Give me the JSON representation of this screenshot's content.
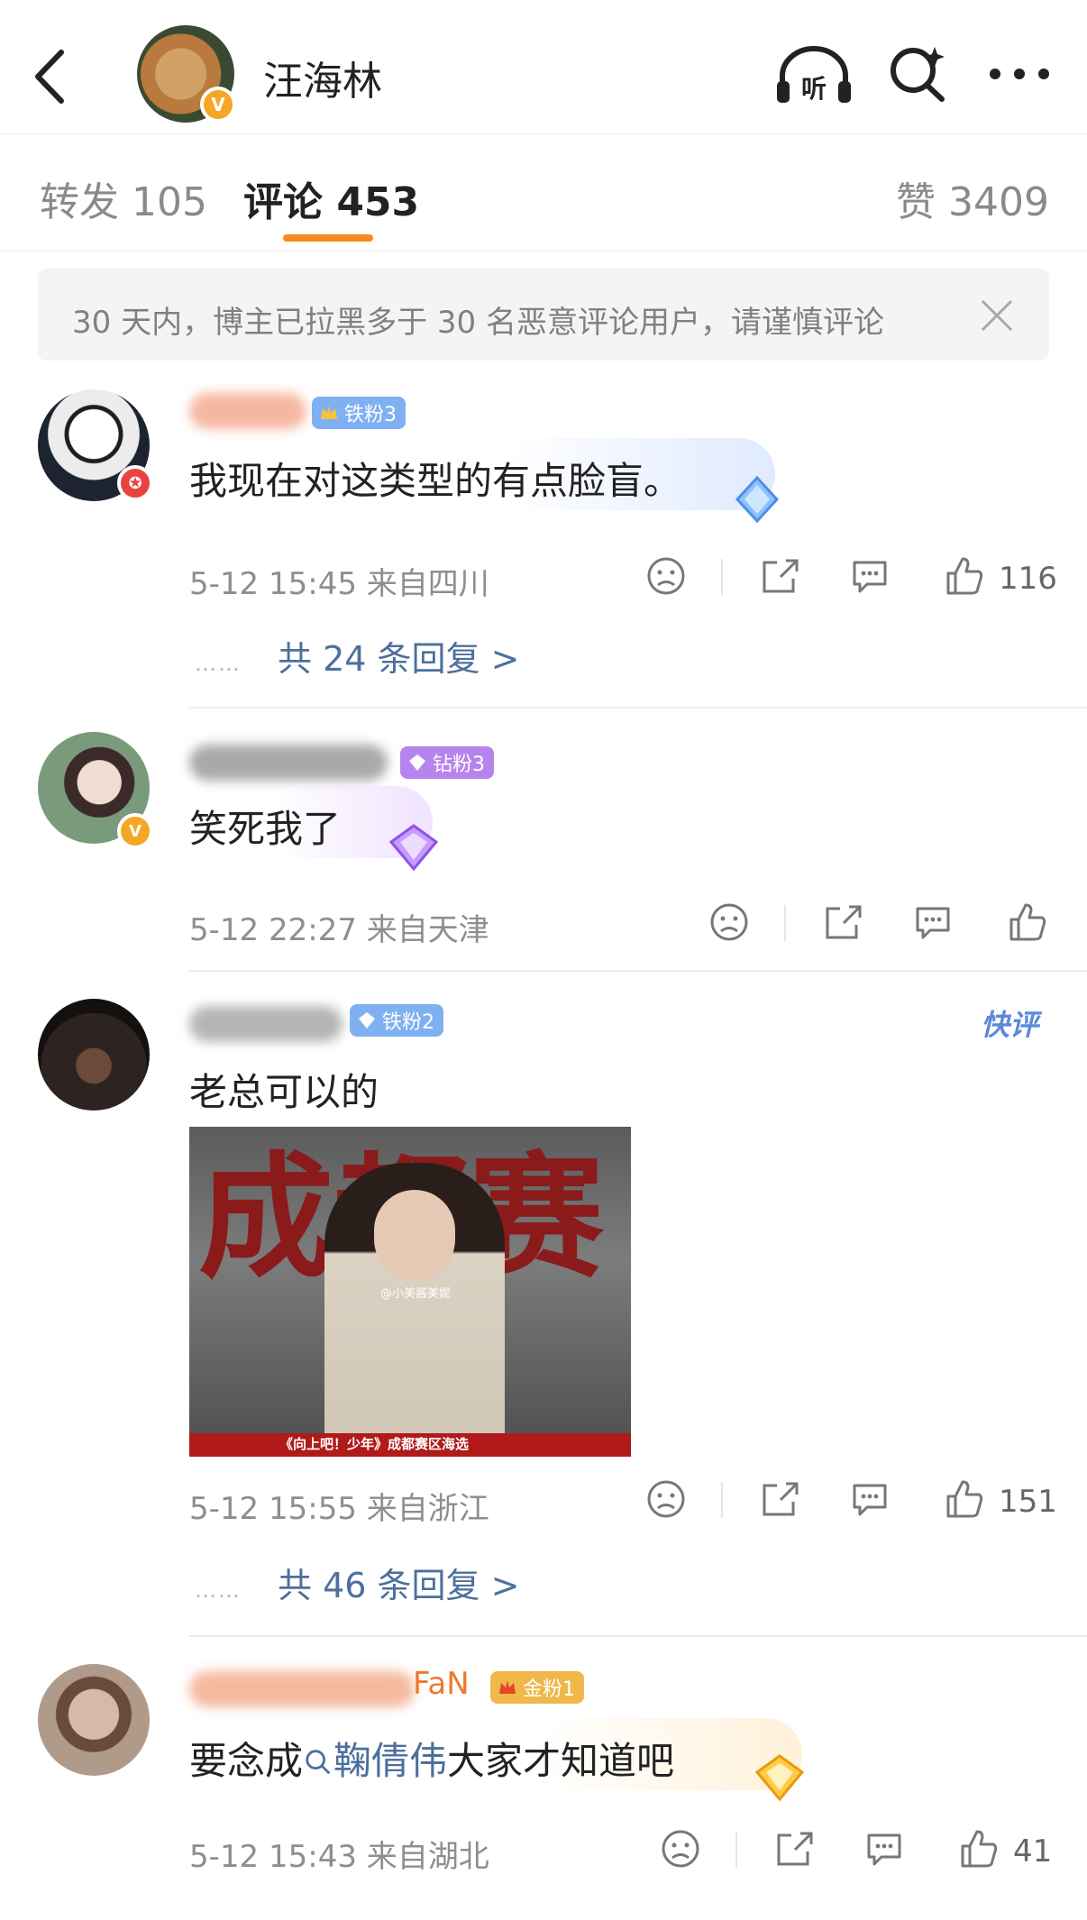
{
  "header": {
    "title": "汪海林",
    "avatar_verified": "V",
    "listen_label": "听"
  },
  "tabs": [
    {
      "label": "转发 105"
    },
    {
      "label": "评论 453"
    },
    {
      "label": "赞 3409"
    }
  ],
  "notice": {
    "text": "30 天内，博主已拉黑多于 30 名恶意评论用户，请谨慎评论"
  },
  "comments": [
    {
      "badge": "铁粉3",
      "text": "我现在对这类型的有点脸盲。",
      "meta": "5-12 15:45  来自四川",
      "likes": "116",
      "replies": "共 24 条回复 >"
    },
    {
      "badge": "钻粉3",
      "text": "笑死我了",
      "meta": "5-12 22:27  来自天津",
      "likes": "",
      "replies": ""
    },
    {
      "badge": "铁粉2",
      "tag": "快评",
      "text": "老总可以的",
      "image_watermark": "@小美酱美妮",
      "image_caption": "《向上吧！少年》成都赛区海选",
      "image_bigtext": "成都赛",
      "meta": "5-12 15:55  来自浙江",
      "likes": "151",
      "replies": "共 46 条回复 >"
    },
    {
      "badge": "金粉1",
      "name_visible": "FaN",
      "text_before": "要念成",
      "link": "鞠倩伟",
      "text_after": "大家才知道吧",
      "meta": "5-12 15:43  来自湖北",
      "likes": "41"
    }
  ],
  "colors": {
    "accent": "#f78a21",
    "link": "#4d6f9c",
    "iron_badge": "#7fb0f2",
    "diamond_badge": "#b784ee",
    "gold_badge": "#f0b84a"
  }
}
